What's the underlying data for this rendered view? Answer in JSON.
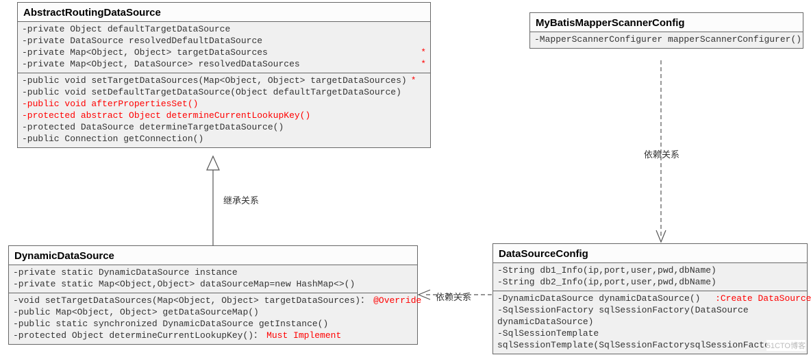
{
  "classes": {
    "abstractRouting": {
      "title": "AbstractRoutingDataSource",
      "fields": [
        {
          "text": "-private Object defaultTargetDataSource",
          "ann": ""
        },
        {
          "text": "-private DataSource resolvedDefaultDataSource",
          "ann": ""
        },
        {
          "text": "-private Map<Object, Object> targetDataSources",
          "ann": "*"
        },
        {
          "text": "-private Map<Object, DataSource> resolvedDataSources",
          "ann": "*"
        }
      ],
      "methods": [
        {
          "text": "-public void setTargetDataSources(Map<Object, Object> targetDataSources)",
          "ann": "*"
        },
        {
          "text": "-public void setDefaultTargetDataSource(Object defaultTargetDataSource)",
          "ann": ""
        },
        {
          "text": "-public void afterPropertiesSet()",
          "ann": "",
          "red": true
        },
        {
          "text": "-protected abstract Object determineCurrentLookupKey()",
          "ann": "",
          "red": true
        },
        {
          "text": "-protected DataSource determineTargetDataSource()",
          "ann": ""
        },
        {
          "text": "-public Connection getConnection()",
          "ann": ""
        }
      ]
    },
    "myBatis": {
      "title": "MyBatisMapperScannerConfig",
      "methods": [
        {
          "text": "-MapperScannerConfigurer mapperScannerConfigurer()",
          "ann": ""
        }
      ]
    },
    "dynamicDS": {
      "title": "DynamicDataSource",
      "fields": [
        {
          "text": "-private static DynamicDataSource instance",
          "ann": ""
        },
        {
          "text": "-private static Map<Object,Object> dataSourceMap=new HashMap<>()",
          "ann": ""
        }
      ],
      "methods": [
        {
          "text": "-void setTargetDataSources(Map<Object, Object> targetDataSources)：",
          "ann": "@Override"
        },
        {
          "text": "-public Map<Object, Object> getDataSourceMap()",
          "ann": ""
        },
        {
          "text": "-public static synchronized DynamicDataSource getInstance()",
          "ann": ""
        },
        {
          "text": "-protected Object determineCurrentLookupKey()：",
          "ann": "Must Implement"
        }
      ]
    },
    "dsConfig": {
      "title": "DataSourceConfig",
      "fields": [
        {
          "text": "-String db1_Info(ip,port,user,pwd,dbName)",
          "ann": ""
        },
        {
          "text": "-String db2_Info(ip,port,user,pwd,dbName)",
          "ann": ""
        }
      ],
      "methods": [
        {
          "text": "-DynamicDataSource dynamicDataSource()  ",
          "ann": ":Create DataSource"
        },
        {
          "text": "-SqlSessionFactory sqlSessionFactory(DataSource",
          "ann": ""
        },
        {
          "text": "dynamicDataSource)",
          "ann": ""
        },
        {
          "text": "-SqlSessionTemplate",
          "ann": ""
        },
        {
          "text": "sqlSessionTemplate(SqlSessionFactorysqlSessionFactory)",
          "ann": ""
        }
      ]
    }
  },
  "labels": {
    "inherit": "继承关系",
    "depend1": "依赖关系",
    "depend2": "依赖关系"
  },
  "watermark": "51CTO博客"
}
